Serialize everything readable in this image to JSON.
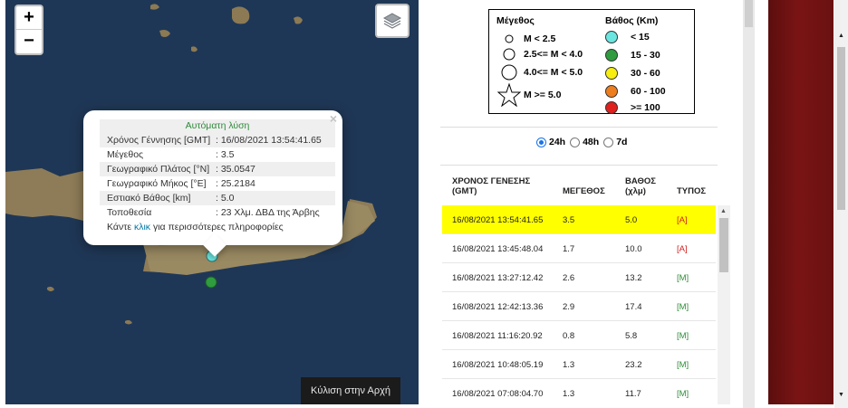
{
  "map": {
    "zoom_in": "+",
    "zoom_out": "−",
    "layers_icon": "layers-icon",
    "popup": {
      "title": "Αυτόματη λύση",
      "close": "×",
      "rows": [
        {
          "k": "Χρόνος Γέννησης [GMT]",
          "v": ": 16/08/2021 13:54:41.65"
        },
        {
          "k": "Μέγεθος",
          "v": ": 3.5"
        },
        {
          "k": "Γεωγραφικό Πλάτος [°N]",
          "v": ": 35.0547"
        },
        {
          "k": "Γεωγραφικό Μήκος [°E]",
          "v": ": 25.2184"
        },
        {
          "k": "Εστιακό Βάθος [km]",
          "v": ": 5.0"
        },
        {
          "k": "Τοποθεσία",
          "v": ": 23 Χλμ. ΔΒΔ της Άρβης"
        }
      ],
      "more_prefix": "Κάντε ",
      "more_link": "κλικ",
      "more_suffix": " για περισσότερες πληροφορίες"
    },
    "scroll_top": "Κύλιση στην Αρχή"
  },
  "legend": {
    "mag_title": "Μέγεθος",
    "depth_title": "Βάθος (Km)",
    "mags": [
      "M < 2.5",
      "2.5<= M < 4.0",
      "4.0<= M < 5.0",
      "M >= 5.0"
    ],
    "depths": [
      {
        "label": "< 15",
        "color": "#6ae5df"
      },
      {
        "label": "15 - 30",
        "color": "#2e9c3f"
      },
      {
        "label": "30 - 60",
        "color": "#f7ee10"
      },
      {
        "label": "60 - 100",
        "color": "#ee7d1e"
      },
      {
        "label": ">= 100",
        "color": "#e0201c"
      }
    ]
  },
  "period": {
    "options": [
      "24h",
      "48h",
      "7d"
    ],
    "selected": "24h"
  },
  "table": {
    "headers": {
      "time_1": "ΧΡΟΝΟΣ ΓΕΝΕΣΗΣ",
      "time_2": "(GMT)",
      "mag": "ΜΕΓΕΘΟΣ",
      "depth_1": "ΒΑΘΟΣ",
      "depth_2": "(χλμ)",
      "type": "ΤΥΠΟΣ"
    },
    "rows": [
      {
        "time": "16/08/2021 13:54:41.65",
        "mag": "3.5",
        "depth": "5.0",
        "type": "[A]"
      },
      {
        "time": "16/08/2021 13:45:48.04",
        "mag": "1.7",
        "depth": "10.0",
        "type": "[A]"
      },
      {
        "time": "16/08/2021 13:27:12.42",
        "mag": "2.6",
        "depth": "13.2",
        "type": "[M]"
      },
      {
        "time": "16/08/2021 12:42:13.36",
        "mag": "2.9",
        "depth": "17.4",
        "type": "[M]"
      },
      {
        "time": "16/08/2021 11:16:20.92",
        "mag": "0.8",
        "depth": "5.8",
        "type": "[M]"
      },
      {
        "time": "16/08/2021 10:48:05.19",
        "mag": "1.3",
        "depth": "23.2",
        "type": "[M]"
      },
      {
        "time": "16/08/2021 07:08:04.70",
        "mag": "1.3",
        "depth": "11.7",
        "type": "[M]"
      }
    ]
  }
}
